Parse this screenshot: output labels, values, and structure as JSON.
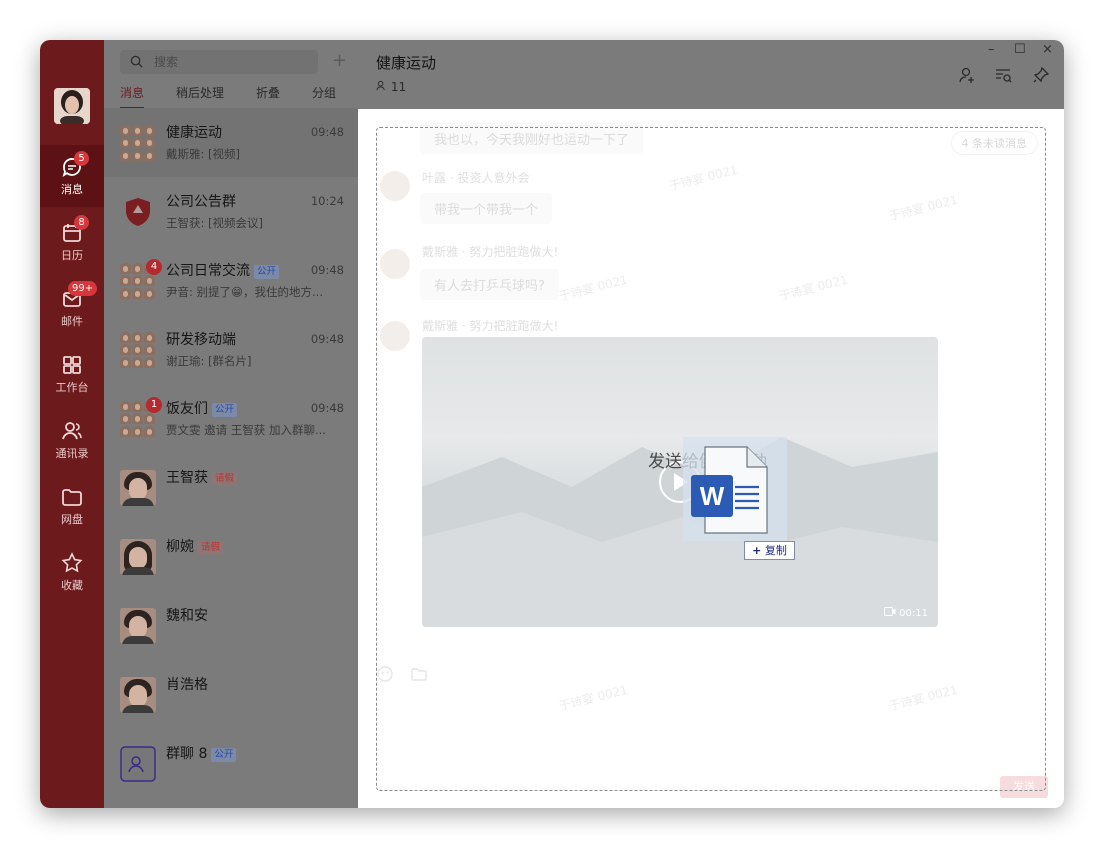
{
  "window_controls": {
    "minimize": "–",
    "maximize": "☐",
    "close": "×"
  },
  "rail": {
    "items": [
      {
        "label": "消息",
        "badge": "5",
        "icon": "chat-icon"
      },
      {
        "label": "日历",
        "badge": "8",
        "icon": "calendar-icon"
      },
      {
        "label": "邮件",
        "badge": "99+",
        "icon": "mail-icon"
      },
      {
        "label": "工作台",
        "badge": "",
        "icon": "grid-icon"
      },
      {
        "label": "通讯录",
        "badge": "",
        "icon": "contacts-icon"
      },
      {
        "label": "网盘",
        "badge": "",
        "icon": "folder-icon"
      },
      {
        "label": "收藏",
        "badge": "",
        "icon": "star-icon"
      }
    ]
  },
  "list": {
    "search_placeholder": "搜索",
    "add_label": "+",
    "tabs": [
      "消息",
      "稍后处理",
      "折叠",
      "分组"
    ],
    "conversations": [
      {
        "name": "健康运动",
        "tag": "",
        "sub": "戴斯雅: [视频]",
        "time": "09:48",
        "badge": ""
      },
      {
        "name": "公司公告群",
        "tag": "",
        "sub": "王智获: [视频会议]",
        "time": "10:24",
        "badge": ""
      },
      {
        "name": "公司日常交流",
        "tag": "公开",
        "sub": "尹音: 别提了😁，我住的地方...",
        "time": "09:48",
        "badge": "4"
      },
      {
        "name": "研发移动端",
        "tag": "",
        "sub": "谢正瑜: [群名片]",
        "time": "09:48",
        "badge": ""
      },
      {
        "name": "饭友们",
        "tag": "公开",
        "sub": "贾文雯 邀请 王智获 加入群聊...",
        "time": "09:48",
        "badge": "1"
      },
      {
        "name": "王智获",
        "tag": "请假",
        "sub": "",
        "time": "",
        "badge": ""
      },
      {
        "name": "柳婉",
        "tag": "请假",
        "sub": "",
        "time": "",
        "badge": ""
      },
      {
        "name": "魏和安",
        "tag": "",
        "sub": "",
        "time": "",
        "badge": ""
      },
      {
        "name": "肖浩格",
        "tag": "",
        "sub": "",
        "time": "",
        "badge": ""
      },
      {
        "name": "群聊 8",
        "tag": "公开",
        "sub": "",
        "time": "",
        "badge": ""
      }
    ]
  },
  "chat": {
    "title": "健康运动",
    "member_count": "11",
    "unread_hint": "4 条未读消息",
    "messages": [
      {
        "sender": "",
        "text": "我也以，今天我刚好也运动一下了"
      },
      {
        "sender": "叶露 · 投资人意外会",
        "text": "带我一个带我一个"
      },
      {
        "sender": "戴斯雅 · 努力把脏跑做大!",
        "text": "有人去打乒乓球吗?"
      },
      {
        "sender": "戴斯雅 · 努力把脏跑做大!",
        "text": ""
      }
    ],
    "video_duration": "00:11",
    "watermark": "于诗宴 0021",
    "send_label": "发送"
  },
  "drag": {
    "drop_label": "发送给健康运动",
    "copy_label": "复制",
    "file_letter": "W"
  },
  "colors": {
    "rail": "#6d1a1d",
    "accent_badge": "#d9363b",
    "word_blue": "#2b5bb5"
  }
}
